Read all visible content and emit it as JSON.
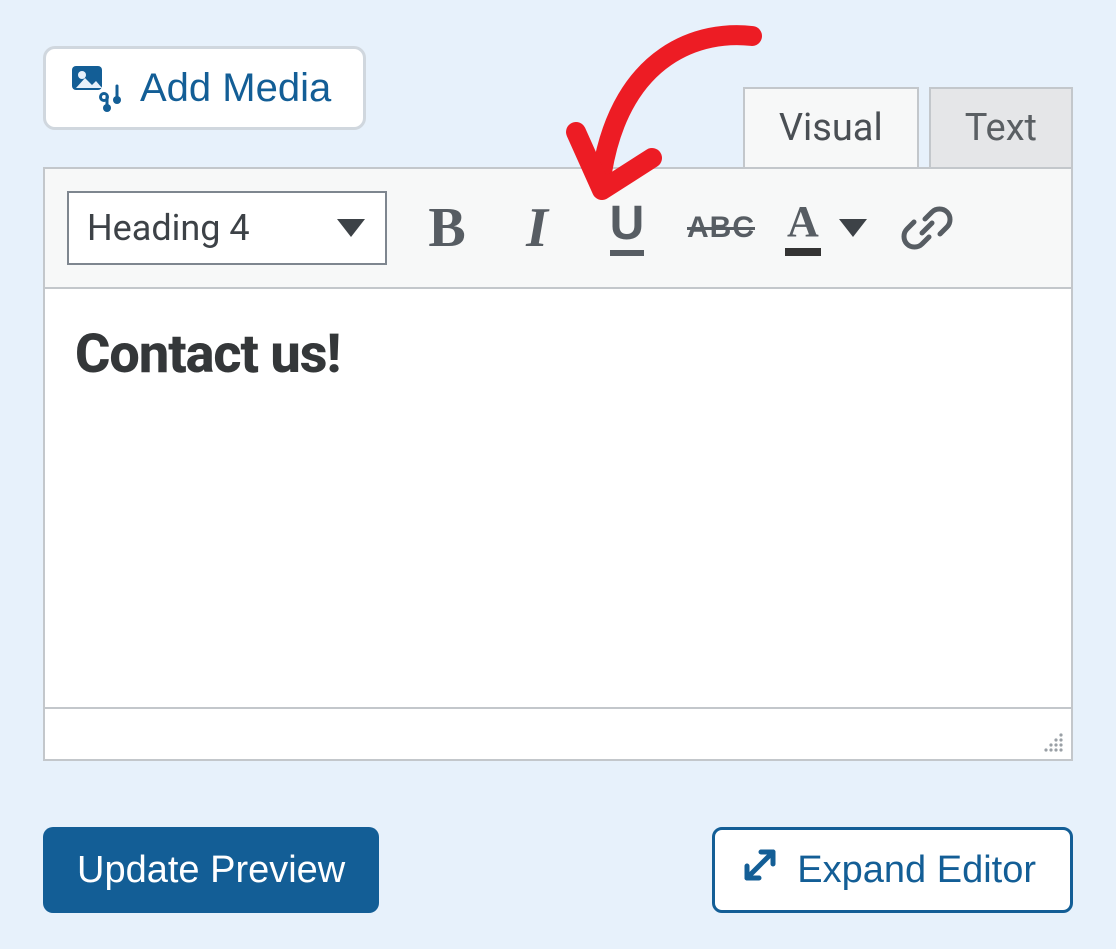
{
  "add_media_button": {
    "label": "Add Media"
  },
  "tabs": {
    "visual": "Visual",
    "text": "Text"
  },
  "toolbar": {
    "format_selected": "Heading 4",
    "bold_symbol": "B",
    "italic_symbol": "I",
    "underline_symbol": "U",
    "strike_symbol": "ABC",
    "textcolor_symbol": "A"
  },
  "editor": {
    "content_heading": "Contact us!"
  },
  "actions": {
    "primary": "Update Preview",
    "secondary": "Expand Editor"
  },
  "colors": {
    "accent": "#135e96",
    "toolbar_icon": "#575d63",
    "arrow": "#ed1c24"
  }
}
